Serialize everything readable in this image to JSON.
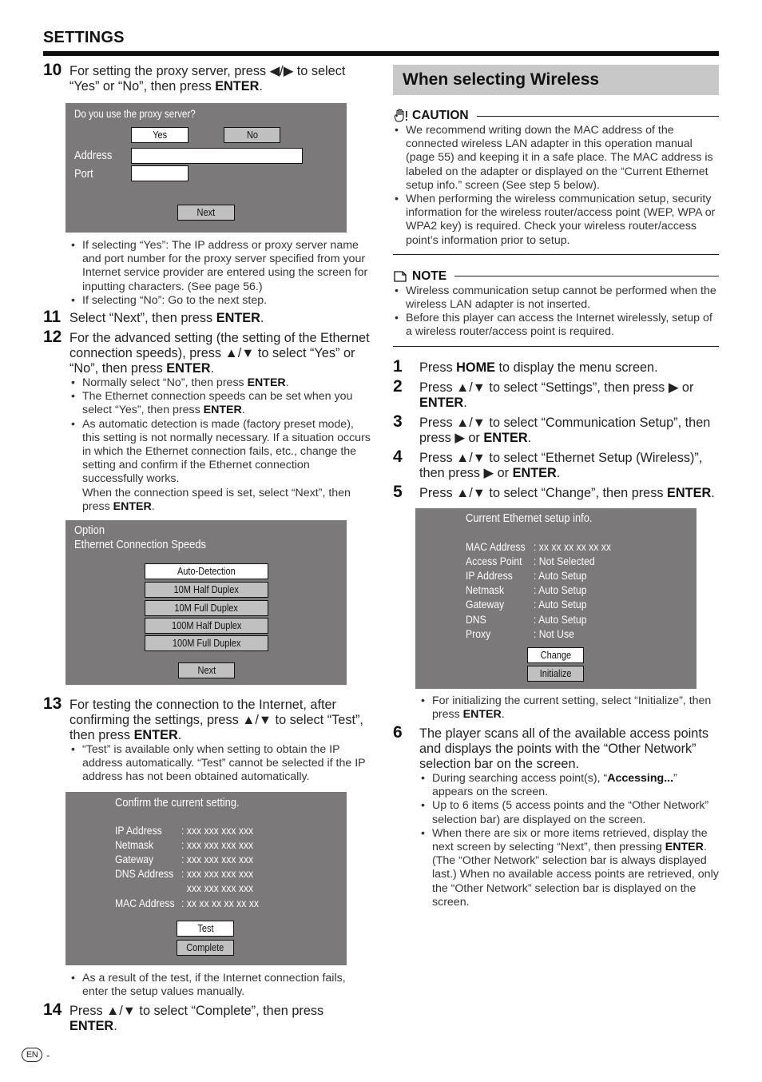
{
  "header": {
    "title": "SETTINGS"
  },
  "left": {
    "step10": {
      "num": "10",
      "text_a": "For setting the proxy server, press ◀/▶ to select “Yes” or “No”, then press ",
      "bold": "ENTER",
      "text_b": ".",
      "panel": {
        "question": "Do you use the proxy server?",
        "yes_label": "Yes",
        "no_label": "No",
        "address_label": "Address",
        "port_label": "Port",
        "address_value": "",
        "port_value": "",
        "next_label": "Next"
      },
      "bullets": [
        "If selecting “Yes”: The IP address or proxy server name and port number for the proxy server specified from your Internet service provider are entered using the screen for inputting characters. (See page 56.)",
        "If selecting “No”: Go to the next step."
      ]
    },
    "step11": {
      "num": "11",
      "text_a": "Select “Next”, then press ",
      "bold": "ENTER",
      "text_b": "."
    },
    "step12": {
      "num": "12",
      "text_a": "For the advanced setting (the setting of the Ethernet connection speeds), press ▲/▼ to select “Yes” or “No”, then press ",
      "bold": "ENTER",
      "text_b": ".",
      "bullets": [
        {
          "a": "Normally select “No”, then press ",
          "b": "ENTER",
          "c": "."
        },
        {
          "a": "The Ethernet connection speeds can be set when you select “Yes”, then press ",
          "b": "ENTER",
          "c": "."
        },
        {
          "a": "As automatic detection is made (factory preset mode), this setting is not normally necessary. If a situation occurs in which the Ethernet connection fails, etc., change the setting and confirm if the Ethernet connection successfully works.",
          "a2": "When the connection speed is set, select “Next”, then press ",
          "b": "ENTER",
          "c": "."
        }
      ],
      "panel": {
        "title1": "Option",
        "title2": "Ethernet Connection Speeds",
        "options": [
          "Auto-Detection",
          "10M Half Duplex",
          "10M Full Duplex",
          "100M Half Duplex",
          "100M Full Duplex"
        ],
        "selected": "Auto-Detection",
        "next_label": "Next"
      }
    },
    "step13": {
      "num": "13",
      "text_a": "For testing the connection to the Internet, after confirming the settings, press ▲/▼ to select “Test”, then press ",
      "bold": "ENTER",
      "text_b": ".",
      "bullets": [
        "“Test” is available only when setting to obtain the IP address automatically. “Test” cannot be selected if the IP address has not been obtained automatically."
      ],
      "panel": {
        "title": "Confirm the current setting.",
        "rows": [
          {
            "key": "IP Address",
            "val": ": xxx xxx xxx xxx"
          },
          {
            "key": "Netmask",
            "val": ": xxx xxx xxx xxx"
          },
          {
            "key": "Gateway",
            "val": ": xxx xxx xxx xxx"
          },
          {
            "key": "DNS Address",
            "val": ": xxx xxx xxx xxx"
          },
          {
            "key": "",
            "val": "  xxx xxx xxx xxx"
          },
          {
            "key": "MAC Address",
            "val": ": xx xx xx xx xx xx"
          }
        ],
        "test_label": "Test",
        "complete_label": "Complete"
      },
      "after_bullets": [
        "As a result of the test, if the Internet connection fails, enter the setup values manually."
      ]
    },
    "step14": {
      "num": "14",
      "text_a": "Press ▲/▼ to select “Complete”, then press ",
      "bold": "ENTER",
      "text_b": "."
    }
  },
  "right": {
    "section_title": "When selecting Wireless",
    "caution": {
      "title": "CAUTION",
      "icon": "caution-hand-icon",
      "bullets": [
        "We recommend writing down the MAC address of the connected wireless LAN adapter in this operation manual (page 55) and keeping it in a safe place. The MAC address is labeled on the adapter or displayed on the “Current Ethernet setup info.” screen (See step 5 below).",
        "When performing the wireless communication setup, security information for the wireless router/access point (WEP, WPA or WPA2 key) is required. Check your wireless router/access point’s information prior to setup."
      ]
    },
    "note": {
      "title": "NOTE",
      "icon": "note-page-icon",
      "bullets": [
        "Wireless communication setup cannot be performed when the wireless LAN adapter is not inserted.",
        "Before this player can access the Internet wirelessly, setup of a wireless router/access point is required."
      ]
    },
    "steps": [
      {
        "num": "1",
        "a": "Press ",
        "b": "HOME",
        "c": " to display the menu screen."
      },
      {
        "num": "2",
        "a": "Press ▲/▼ to select “Settings”, then press ▶ or ",
        "b": "ENTER",
        "c": "."
      },
      {
        "num": "3",
        "a": "Press ▲/▼ to select “Communication Setup”, then press ▶ or ",
        "b": "ENTER",
        "c": "."
      },
      {
        "num": "4",
        "a": "Press ▲/▼ to select “Ethernet Setup (Wireless)”, then press ▶ or ",
        "b": "ENTER",
        "c": "."
      },
      {
        "num": "5",
        "a": "Press ▲/▼ to select “Change”, then press ",
        "b": "ENTER",
        "c": "."
      }
    ],
    "panel": {
      "title": "Current Ethernet setup info.",
      "rows": [
        {
          "key": "MAC Address",
          "val": ": xx xx xx xx xx xx"
        },
        {
          "key": "Access Point",
          "val": ": Not Selected"
        },
        {
          "key": "IP Address",
          "val": ": Auto Setup"
        },
        {
          "key": "Netmask",
          "val": ": Auto Setup"
        },
        {
          "key": "Gateway",
          "val": ": Auto Setup"
        },
        {
          "key": "DNS",
          "val": ": Auto Setup"
        },
        {
          "key": "Proxy",
          "val": ": Not Use"
        }
      ],
      "change_label": "Change",
      "initialize_label": "Initialize"
    },
    "step5_bullets": [
      {
        "a": "For initializing the current setting, select “Initialize”, then press ",
        "b": "ENTER",
        "c": "."
      }
    ],
    "step6": {
      "num": "6",
      "text": "The player scans all of the available access points and displays the points with the “Other Network” selection bar on the screen.",
      "bullets": [
        {
          "a": "During searching access point(s), “",
          "b": "Accessing...",
          "c": "” appears on the screen."
        },
        {
          "a": "Up to 6 items (5 access points and the “Other Network” selection bar) are displayed on the screen.",
          "b": "",
          "c": ""
        },
        {
          "a": "When there are six or more items retrieved, display the next screen by selecting “Next”, then pressing ",
          "b": "ENTER",
          "c": ". (The “Other Network” selection bar is always displayed last.) When no available access points are retrieved, only the “Other Network” selection bar is displayed on the screen."
        }
      ]
    }
  },
  "footer": {
    "lang": "EN",
    "page_suffix": "-"
  },
  "colors": {
    "panel_bg": "#7b797a",
    "button_bg": "#c0c0c0",
    "heading_bg": "#c8c8c8",
    "rule": "#111111"
  }
}
